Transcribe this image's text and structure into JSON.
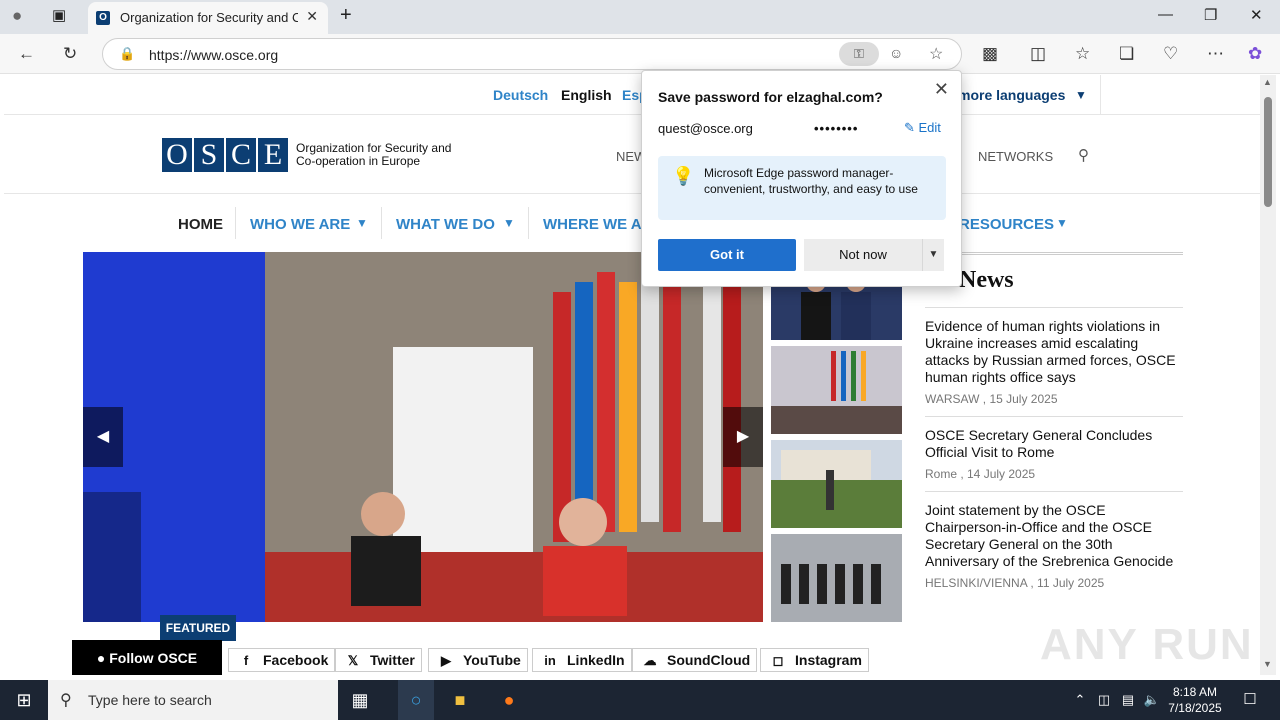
{
  "browser": {
    "tab_title": "Organization for Security and Co-operation in Europe",
    "url": "https://www.osce.org"
  },
  "site": {
    "languages": [
      "Deutsch",
      "English",
      "Esp"
    ],
    "more_languages": "more languages",
    "logo_letters": [
      "O",
      "S",
      "C",
      "E"
    ],
    "logo_text_line1": "Organization for Security and",
    "logo_text_line2": "Co-operation in Europe",
    "header_links": [
      "NEW",
      "NETWORKS"
    ],
    "nav": [
      "HOME",
      "WHO WE ARE",
      "WHAT WE DO",
      "WHERE WE AR",
      "RESOURCES"
    ],
    "featured_label": "FEATURED",
    "latest_header": "est News",
    "news": [
      {
        "headline": "Evidence of human rights violations in Ukraine increases amid escalating attacks by Russian armed forces, OSCE human rights office says",
        "meta": "WARSAW , 15 July 2025"
      },
      {
        "headline": "OSCE Secretary General Concludes Official Visit to Rome",
        "meta": "Rome , 14 July 2025"
      },
      {
        "headline": "Joint statement by the OSCE Chairperson-in-Office and the OSCE Secretary General on the 30th Anniversary of the Srebrenica Genocide",
        "meta": "HELSINKI/VIENNA , 11 July 2025"
      }
    ],
    "follow_label": "Follow OSCE",
    "social": [
      "Facebook",
      "Twitter",
      "YouTube",
      "LinkedIn",
      "SoundCloud",
      "Instagram"
    ]
  },
  "popup": {
    "title": "Save password for elzaghal.com?",
    "username": "quest@osce.org",
    "password_mask": "••••••••",
    "edit_label": "Edit",
    "promo_text": "Microsoft Edge password manager- convenient, trustworthy, and easy to use",
    "got_it": "Got it",
    "not_now": "Not now"
  },
  "taskbar": {
    "search_placeholder": "Type here to search",
    "time": "8:18 AM",
    "date": "7/18/2025"
  },
  "watermark": "ANY RUN",
  "colors": {
    "osce_blue": "#0c3e73",
    "link_blue": "#2f84c8",
    "edge_blue": "#1f6fcc"
  }
}
